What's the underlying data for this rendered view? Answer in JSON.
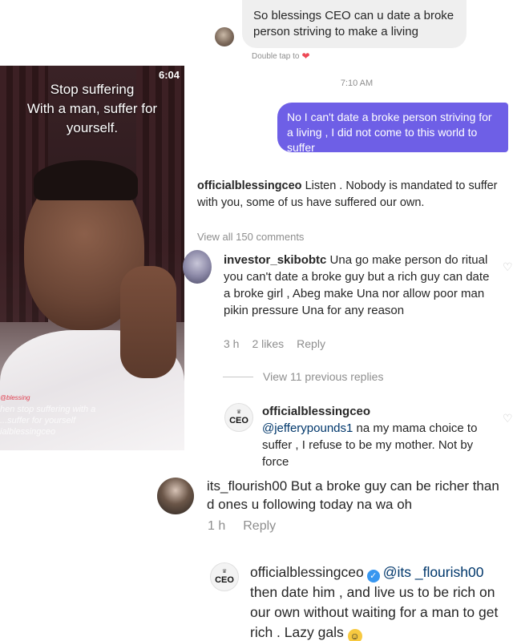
{
  "dm": {
    "incoming_text": "So blessings CEO can u date a broke person striving to make a living",
    "double_tap_label": "Double tap to",
    "heart_icon": "heart-icon",
    "time": "7:10 AM",
    "outgoing_text": "No I can't date a broke person striving for a living , I did not come to this world to suffer"
  },
  "video": {
    "time": "6:04",
    "caption_line1": "Stop suffering",
    "caption_line2": "With a man, suffer for",
    "caption_line3": "yourself.",
    "watermark_tag": "@blessing",
    "watermark_line1": "hen stop suffering with a",
    "watermark_line2": "...suffer for yourself",
    "watermark_line3": "ialblessingceo"
  },
  "post_caption": {
    "username": "officialblessingceo",
    "text": "Listen . Nobody is mandated to suffer with you, some  of us have suffered our own.",
    "view_all": "View all 150 comments"
  },
  "comments": [
    {
      "username": "investor_skibobtc",
      "text": "Una go make person do ritual you can't date a broke guy but a rich guy can date a broke girl , Abeg make Una nor allow poor man pikin pressure Una for any reason",
      "time": "3 h",
      "likes": "2 likes",
      "reply": "Reply",
      "view_replies": "View 11 previous replies"
    },
    {
      "avatar_text": "CEO",
      "username": "officialblessingceo",
      "mention": "@jefferypounds1",
      "text": "na my mama choice to suffer , I refuse to be my mother. Not by force"
    },
    {
      "username": "its_flourish00",
      "text": "But a broke guy can be richer than d ones u following today na wa oh",
      "time": "1 h",
      "reply": "Reply"
    },
    {
      "avatar_text": "CEO",
      "username": "officialblessingceo",
      "verified_icon": "verified-badge-icon",
      "mention": "@its _flourish00",
      "text": "then date him , and live us to be rich on our own without waiting for a man to get rich . Lazy gals",
      "emoji": "grinning-sweat-emoji"
    }
  ],
  "colors": {
    "outgoing_bubble": "#6e5fe6",
    "incoming_bubble": "#efefef",
    "verified": "#3897f0",
    "muted": "#8e8e8e"
  }
}
